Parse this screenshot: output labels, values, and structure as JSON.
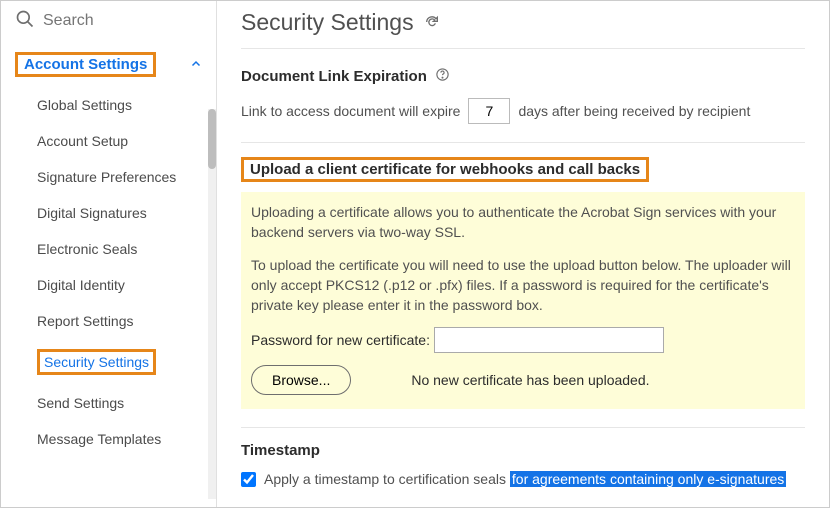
{
  "search": {
    "placeholder": "Search"
  },
  "sidebar": {
    "header": "Account Settings",
    "items": [
      {
        "label": "Global Settings"
      },
      {
        "label": "Account Setup"
      },
      {
        "label": "Signature Preferences"
      },
      {
        "label": "Digital Signatures"
      },
      {
        "label": "Electronic Seals"
      },
      {
        "label": "Digital Identity"
      },
      {
        "label": "Report Settings"
      },
      {
        "label": "Security Settings"
      },
      {
        "label": "Send Settings"
      },
      {
        "label": "Message Templates"
      }
    ]
  },
  "page": {
    "title": "Security Settings"
  },
  "expire": {
    "heading": "Document Link Expiration",
    "pre": "Link to access document will expire",
    "value": "7",
    "post": "days after being received by recipient"
  },
  "cert": {
    "heading": "Upload a client certificate for webhooks and call backs",
    "p1": "Uploading a certificate allows you to authenticate the Acrobat Sign services with your backend servers via two-way SSL.",
    "p2": "To upload the certificate you will need to use the upload button below. The uploader will only accept PKCS12 (.p12 or .pfx) files. If a password is required for the certificate's private key please enter it in the password box.",
    "pw_label": "Password for new certificate:",
    "browse": "Browse...",
    "status": "No new certificate has been uploaded."
  },
  "ts": {
    "heading": "Timestamp",
    "pre": "Apply a timestamp to certification seals ",
    "hl": "for agreements containing only e-signatures"
  }
}
